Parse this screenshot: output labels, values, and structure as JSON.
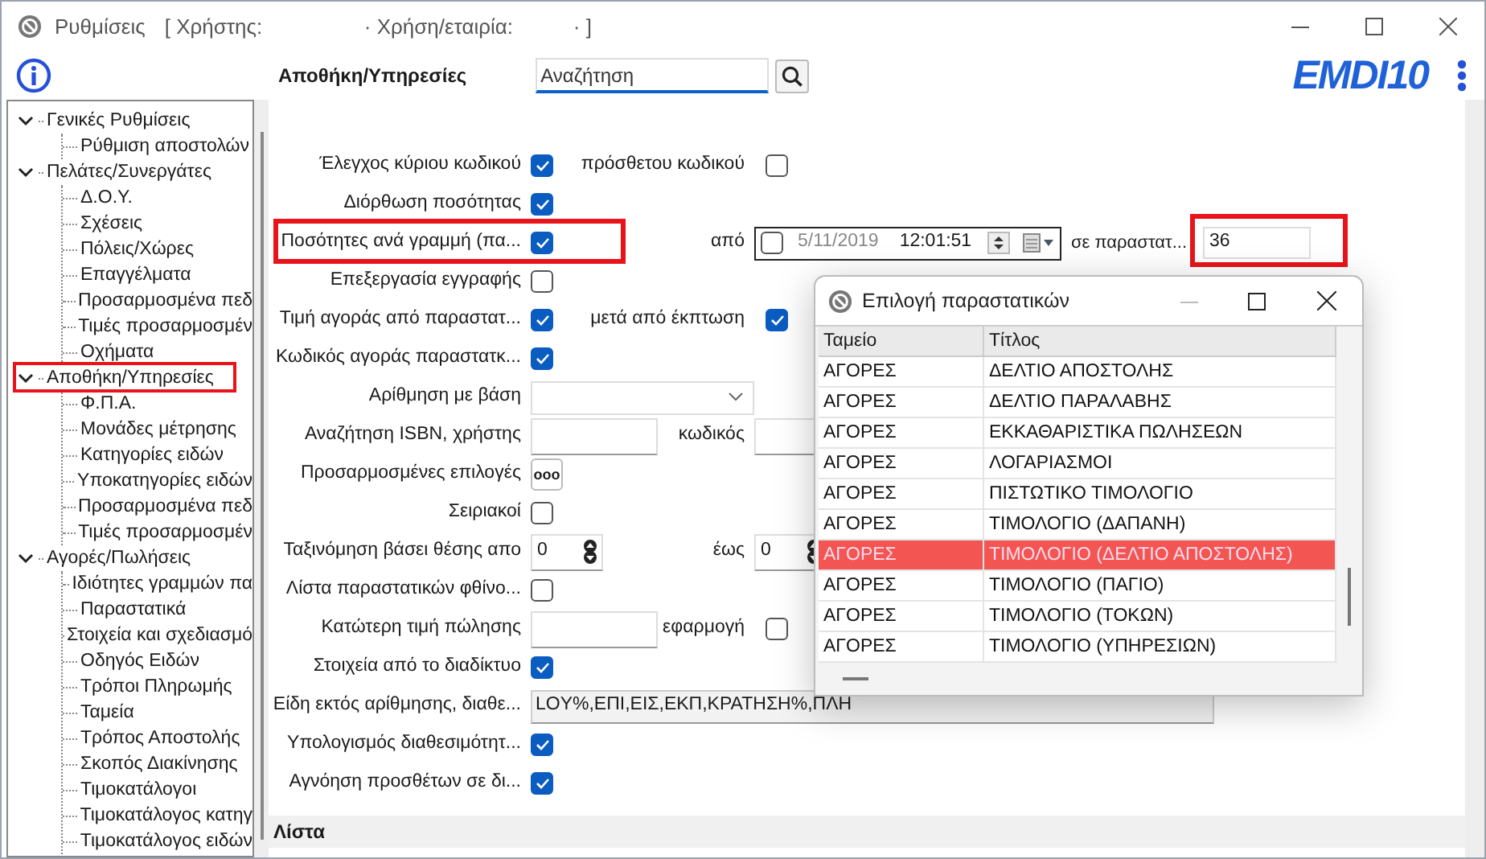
{
  "window": {
    "title": "Ρυθμίσεις",
    "title_user": "[ Χρήστης:",
    "title_company": "· Χρήση/εταιρία:",
    "title_end": "· ]"
  },
  "header": {
    "section_title": "Αποθήκη/Υπηρεσίες",
    "search": {
      "placeholder": "Αναζήτηση"
    },
    "logo": "EMDI10"
  },
  "tree": [
    {
      "label": "Γενικές Ρυθμίσεις",
      "expanded": true,
      "children": [
        {
          "label": "Ρύθμιση αποστολών"
        }
      ]
    },
    {
      "label": "Πελάτες/Συνεργάτες",
      "expanded": true,
      "children": [
        {
          "label": "Δ.Ο.Υ."
        },
        {
          "label": "Σχέσεις"
        },
        {
          "label": "Πόλεις/Χώρες"
        },
        {
          "label": "Επαγγέλματα"
        },
        {
          "label": "Προσαρμοσμένα πεδ"
        },
        {
          "label": "Τιμές προσαρμοσμέν"
        },
        {
          "label": "Οχήματα"
        }
      ]
    },
    {
      "label": "Αποθήκη/Υπηρεσίες",
      "expanded": true,
      "children": [
        {
          "label": "Φ.Π.Α."
        },
        {
          "label": "Μονάδες μέτρησης"
        },
        {
          "label": "Κατηγορίες ειδών"
        },
        {
          "label": "Υποκατηγορίες ειδών"
        },
        {
          "label": "Προσαρμοσμένα πεδ"
        },
        {
          "label": "Τιμές προσαρμοσμέν"
        }
      ]
    },
    {
      "label": "Αγορές/Πωλήσεις",
      "expanded": true,
      "children": [
        {
          "label": "Ιδιότητες γραμμών πα"
        },
        {
          "label": "Παραστατικά"
        },
        {
          "label": "Στοιχεία και σχεδιασμό"
        },
        {
          "label": "Οδηγός Ειδών"
        },
        {
          "label": "Τρόποι Πληρωμής"
        },
        {
          "label": "Ταμεία"
        },
        {
          "label": "Τρόπος Αποστολής"
        },
        {
          "label": "Σκοπός Διακίνησης"
        },
        {
          "label": "Τιμοκατάλογοι"
        },
        {
          "label": "Τιμοκατάλογος κατηγ"
        },
        {
          "label": "Τιμοκατάλογος ειδών"
        }
      ]
    }
  ],
  "form": {
    "rows": [
      {
        "label": "Έλεγχος κύριου κωδικού",
        "kind": "checkbox",
        "checked": true,
        "extra": {
          "label": "πρόσθετου κωδικού",
          "kind": "checkbox",
          "checked": false
        }
      },
      {
        "label": "Διόρθωση ποσότητας",
        "kind": "checkbox",
        "checked": true
      },
      {
        "label": "Ποσότητες ανά γραμμή (πα...",
        "kind": "checkbox",
        "checked": true,
        "extra": {
          "label": "από",
          "kind": "datetime",
          "checked": false,
          "date": "5/11/2019",
          "time": "12:01:51"
        },
        "extra2": {
          "label": "σε παραστατ...",
          "value": "36"
        }
      },
      {
        "label": "Επεξεργασία εγγραφής",
        "kind": "checkbox",
        "checked": false
      },
      {
        "label": "Τιμή αγοράς από παραστατ...",
        "kind": "checkbox",
        "checked": true,
        "extra": {
          "label": "μετά από έκπτωση",
          "kind": "checkbox",
          "checked": true
        }
      },
      {
        "label": "Κωδικός αγοράς παραστατκ...",
        "kind": "checkbox",
        "checked": true
      },
      {
        "label": "Αρίθμηση με βάση",
        "kind": "dropdown"
      },
      {
        "label": "Αναζήτηση ISBN, χρήστης",
        "kind": "input",
        "extra": {
          "label": "κωδικός",
          "kind": "input"
        }
      },
      {
        "label": "Προσαρμοσμένες επιλογές",
        "kind": "button",
        "text": "ooo"
      },
      {
        "label": "Σειριακοί",
        "kind": "checkbox",
        "checked": false
      },
      {
        "label": "Ταξινόμηση βάσει θέσης απο",
        "kind": "spinner",
        "value": "0",
        "extra": {
          "label": "έως",
          "kind": "spinner",
          "value": "0"
        }
      },
      {
        "label": "Λίστα παραστατικών φθίνο...",
        "kind": "checkbox",
        "checked": false
      },
      {
        "label": "Κατώτερη τιμή πώλησης",
        "kind": "input",
        "extra": {
          "label": "εφαρμογή",
          "kind": "checkbox",
          "checked": false
        }
      },
      {
        "label": "Στοιχεία από το διαδίκτυο",
        "kind": "checkbox",
        "checked": true
      },
      {
        "label": "Είδη εκτός αρίθμησης, διαθε...",
        "kind": "wide",
        "value": "LOY%,ΕΠΙ,ΕΙΣ,ΕΚΠ,ΚΡΑΤΗΣΗ%,ΠΛΗ"
      },
      {
        "label": "Υπολογισμός διαθεσιμότητ...",
        "kind": "checkbox",
        "checked": true
      },
      {
        "label": "Αγνόηση προσθέτων σε δι...",
        "kind": "checkbox",
        "checked": true
      }
    ],
    "section": "Λίστα"
  },
  "dialog": {
    "title": "Επιλογή παραστατικών",
    "columns": [
      "Ταμείο",
      "Τίτλος"
    ],
    "rows": [
      {
        "cells": [
          "ΑΓΟΡΕΣ",
          "ΔΕΛΤΙΟ ΑΠΟΣΤΟΛΗΣ"
        ],
        "selected": false
      },
      {
        "cells": [
          "ΑΓΟΡΕΣ",
          "ΔΕΛΤΙΟ ΠΑΡΑΛΑΒΗΣ"
        ],
        "selected": false
      },
      {
        "cells": [
          "ΑΓΟΡΕΣ",
          "ΕΚΚΑΘΑΡΙΣΤΙΚΑ ΠΩΛΗΣΕΩΝ"
        ],
        "selected": false
      },
      {
        "cells": [
          "ΑΓΟΡΕΣ",
          "ΛΟΓΑΡΙΑΣΜΟΙ"
        ],
        "selected": false
      },
      {
        "cells": [
          "ΑΓΟΡΕΣ",
          "ΠΙΣΤΩΤΙΚΟ ΤΙΜΟΛΟΓΙΟ"
        ],
        "selected": false
      },
      {
        "cells": [
          "ΑΓΟΡΕΣ",
          "ΤΙΜΟΛΟΓΙΟ (ΔΑΠΑΝΗ)"
        ],
        "selected": false
      },
      {
        "cells": [
          "ΑΓΟΡΕΣ",
          "ΤΙΜΟΛΟΓΙΟ (ΔΕΛΤΙΟ ΑΠΟΣΤΟΛΗΣ)"
        ],
        "selected": true
      },
      {
        "cells": [
          "ΑΓΟΡΕΣ",
          "ΤΙΜΟΛΟΓΙΟ (ΠΑΓΙΟ)"
        ],
        "selected": false
      },
      {
        "cells": [
          "ΑΓΟΡΕΣ",
          "ΤΙΜΟΛΟΓΙΟ (ΤΟΚΩΝ)"
        ],
        "selected": false
      },
      {
        "cells": [
          "ΑΓΟΡΕΣ",
          "ΤΙΜΟΛΟΓΙΟ (ΥΠΗΡΕΣΙΩΝ)"
        ],
        "selected": false
      }
    ]
  }
}
